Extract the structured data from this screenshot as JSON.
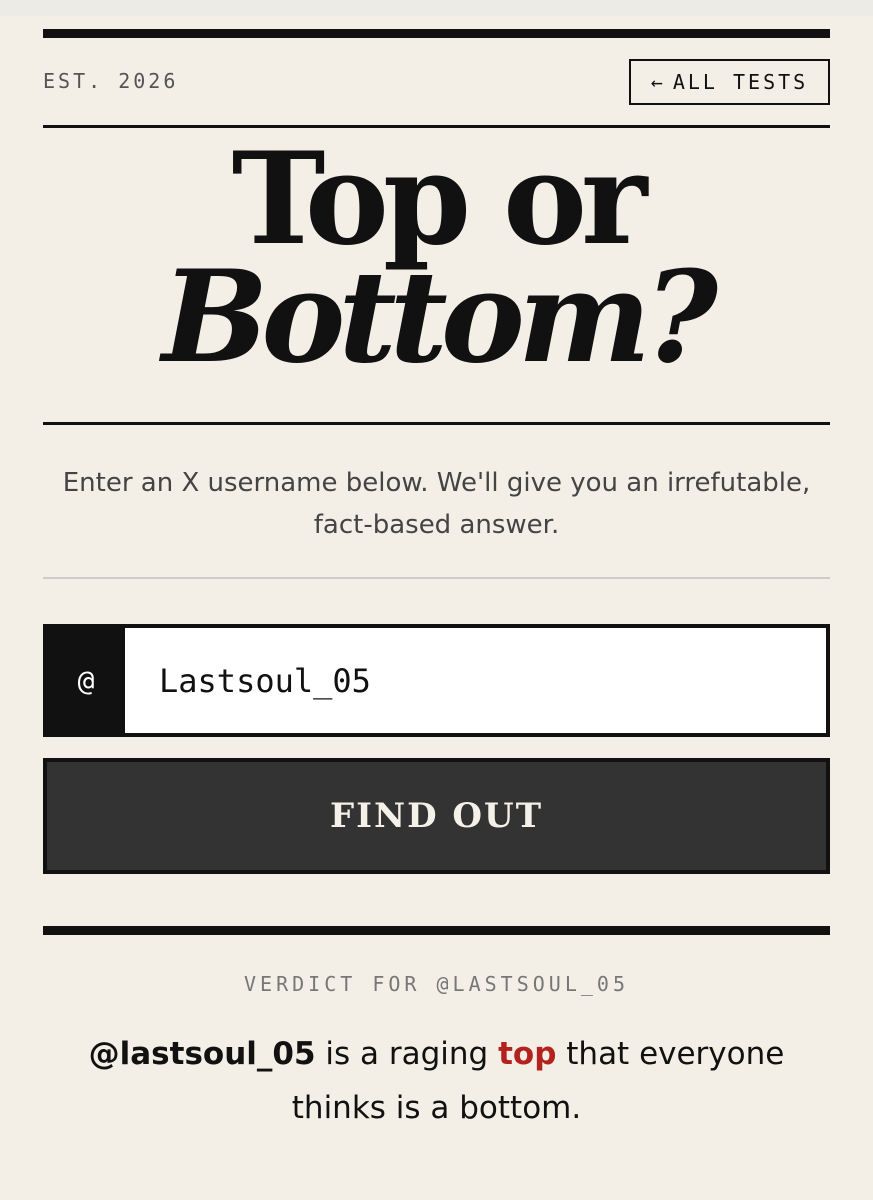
{
  "header": {
    "est": "EST. 2026",
    "all_tests_arrow": "←",
    "all_tests_label": "ALL TESTS"
  },
  "title": {
    "line1": "Top or",
    "line2": "Bottom?"
  },
  "intro": "Enter an X username below. We'll give you an irrefutable, fact-based answer.",
  "form": {
    "at_symbol": "@",
    "username_value": "Lastsoul_05",
    "submit_label": "FIND OUT"
  },
  "result": {
    "label": "VERDICT FOR @LASTSOUL_05",
    "handle": "@lastsoul_05",
    "text_before": " is a raging ",
    "accent_word": "top",
    "text_after": " that everyone thinks is a bottom."
  },
  "colors": {
    "background": "#f3efe7",
    "ink": "#111111",
    "button": "#333333",
    "accent": "#b3221f"
  }
}
